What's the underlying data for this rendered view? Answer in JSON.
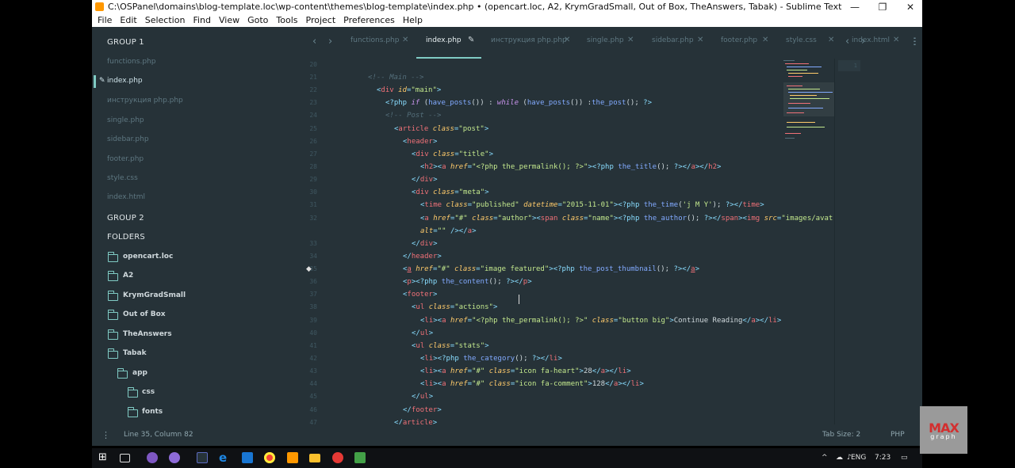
{
  "window": {
    "title": "C:\\OSPanel\\domains\\blog-template.loc\\wp-content\\themes\\blog-template\\index.php • (opencart.loc, A2, KrymGradSmall, Out of Box, TheAnswers, Tabak) - Sublime Text",
    "controls": {
      "minimize": "—",
      "maximize": "❐",
      "close": "✕"
    }
  },
  "menu": [
    "File",
    "Edit",
    "Selection",
    "Find",
    "View",
    "Goto",
    "Tools",
    "Project",
    "Preferences",
    "Help"
  ],
  "sidebar": {
    "group1": "GROUP 1",
    "files": [
      {
        "label": "functions.php",
        "active": false
      },
      {
        "label": "index.php",
        "active": true
      },
      {
        "label": "инструкция php.php",
        "active": false
      },
      {
        "label": "single.php",
        "active": false
      },
      {
        "label": "sidebar.php",
        "active": false
      },
      {
        "label": "footer.php",
        "active": false
      },
      {
        "label": "style.css",
        "active": false
      },
      {
        "label": "index.html",
        "active": false
      }
    ],
    "group2": "GROUP 2",
    "folders_label": "FOLDERS",
    "folders": [
      {
        "label": "opencart.loc",
        "level": 0
      },
      {
        "label": "A2",
        "level": 0
      },
      {
        "label": "KrymGradSmall",
        "level": 0
      },
      {
        "label": "Out of Box",
        "level": 0
      },
      {
        "label": "TheAnswers",
        "level": 0
      },
      {
        "label": "Tabak",
        "level": 0
      },
      {
        "label": "app",
        "level": 1
      },
      {
        "label": "css",
        "level": 2
      },
      {
        "label": "fonts",
        "level": 2
      }
    ]
  },
  "tabs": [
    {
      "label": "functions.php",
      "active": false
    },
    {
      "label": "index.php",
      "active": true
    },
    {
      "label": "инструкция php.php",
      "active": false
    },
    {
      "label": "single.php",
      "active": false
    },
    {
      "label": "sidebar.php",
      "active": false
    },
    {
      "label": "footer.php",
      "active": false
    },
    {
      "label": "style.css",
      "active": false
    },
    {
      "label": "index.html",
      "active": false
    }
  ],
  "tab_close_glyph": "✕",
  "tab_dirty_glyph": "✎",
  "line_numbers": [
    "20",
    "21",
    "22",
    "23",
    "24",
    "25",
    "26",
    "27",
    "28",
    "29",
    "30",
    "31",
    "32",
    "",
    "33",
    "34",
    "35",
    "36",
    "37",
    "38",
    "39",
    "40",
    "41",
    "42",
    "43",
    "44",
    "45",
    "46",
    "47"
  ],
  "right_pane_line": "1",
  "status": {
    "position": "Line 35, Column 82",
    "tab_size": "Tab Size: 2",
    "syntax": "PHP"
  },
  "taskbar": {
    "language": "ENG",
    "time": "7:23"
  },
  "watermark": {
    "main": "MAX",
    "sub": "graph"
  },
  "colors": {
    "editor_bg": "#263238",
    "accent": "#80cbc4",
    "tag": "#f07178",
    "attr": "#ffcb6b",
    "string": "#c3e88d",
    "keyword": "#c792ea",
    "function": "#82aaff",
    "comment": "#546e7a"
  }
}
